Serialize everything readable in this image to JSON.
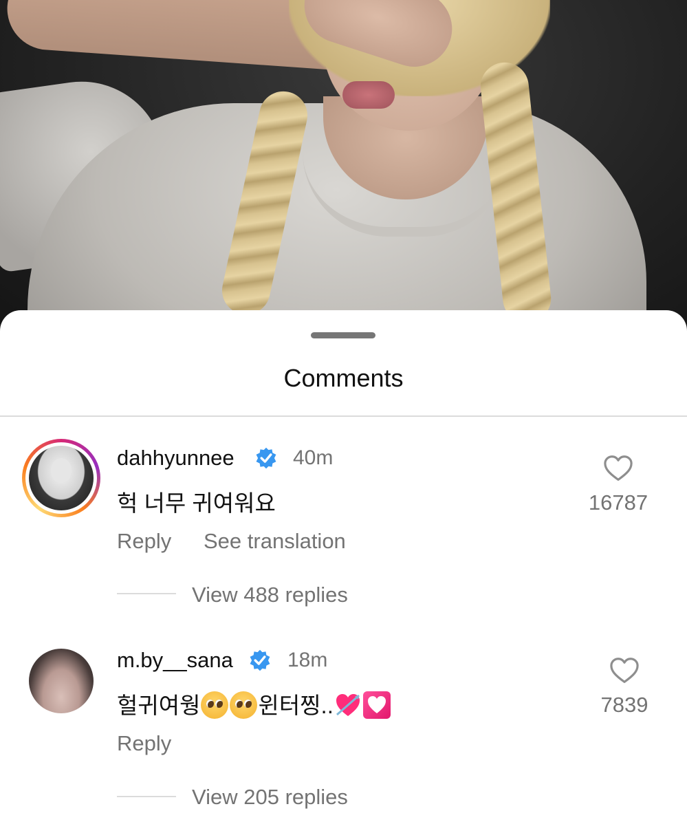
{
  "sheet": {
    "title": "Comments"
  },
  "comments": [
    {
      "username": "dahhyunnee",
      "verified": true,
      "time": "40m",
      "text": "헉 너무 귀여워요",
      "reply_label": "Reply",
      "translate_label": "See translation",
      "view_replies": "View 488 replies",
      "likes": "16787",
      "has_story_ring": true
    },
    {
      "username": "m.by__sana",
      "verified": true,
      "time": "18m",
      "text_prefix": "헐귀여웡",
      "text_middle": "윈터찡..",
      "emojis": [
        "pleading-face",
        "pleading-face",
        "heart-with-arrow",
        "heart-decoration"
      ],
      "reply_label": "Reply",
      "view_replies": "View 205 replies",
      "likes": "7839",
      "has_story_ring": false
    }
  ],
  "colors": {
    "accent_verified": "#3897f0",
    "secondary_text": "#737373",
    "story_ring": [
      "#d62976",
      "#962fbf",
      "#fa7e1e",
      "#feda75"
    ]
  }
}
